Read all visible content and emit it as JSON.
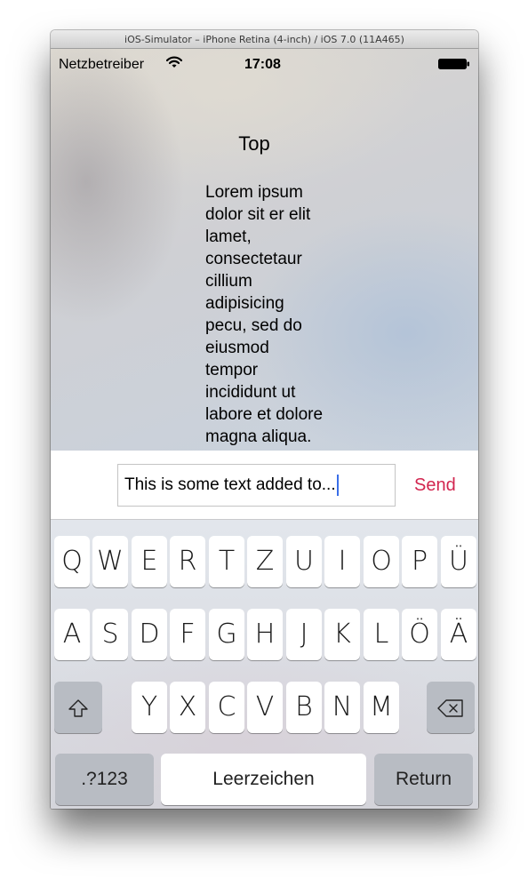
{
  "window": {
    "title": "iOS-Simulator – iPhone Retina (4-inch) / iOS 7.0 (11A465)"
  },
  "status_bar": {
    "carrier": "Netzbetreiber",
    "time": "17:08",
    "wifi_icon": "wifi-icon",
    "battery_icon": "battery-full-icon"
  },
  "content": {
    "title": "Top",
    "body_lines": [
      "Lorem ipsum",
      "dolor sit er elit",
      "lamet,",
      "consectetaur",
      "cillium",
      "adipisicing",
      "pecu, sed do",
      "eiusmod",
      "tempor",
      "incididunt ut",
      "labore et dolore",
      "magna aliqua."
    ]
  },
  "composer": {
    "text": "This is some text added to...",
    "send_label": "Send",
    "send_color": "#d2254f",
    "caret_color": "#3a6ee8"
  },
  "keyboard": {
    "row1": [
      "Q",
      "W",
      "E",
      "R",
      "T",
      "Z",
      "U",
      "I",
      "O",
      "P",
      "Ü"
    ],
    "row2": [
      "A",
      "S",
      "D",
      "F",
      "G",
      "H",
      "J",
      "K",
      "L",
      "Ö",
      "Ä"
    ],
    "row3": [
      "Y",
      "X",
      "C",
      "V",
      "B",
      "N",
      "M"
    ],
    "shift_icon": "shift-arrow-icon",
    "delete_icon": "backspace-icon",
    "numbers_label": ".?123",
    "space_label": "Leerzeichen",
    "return_label": "Return"
  }
}
